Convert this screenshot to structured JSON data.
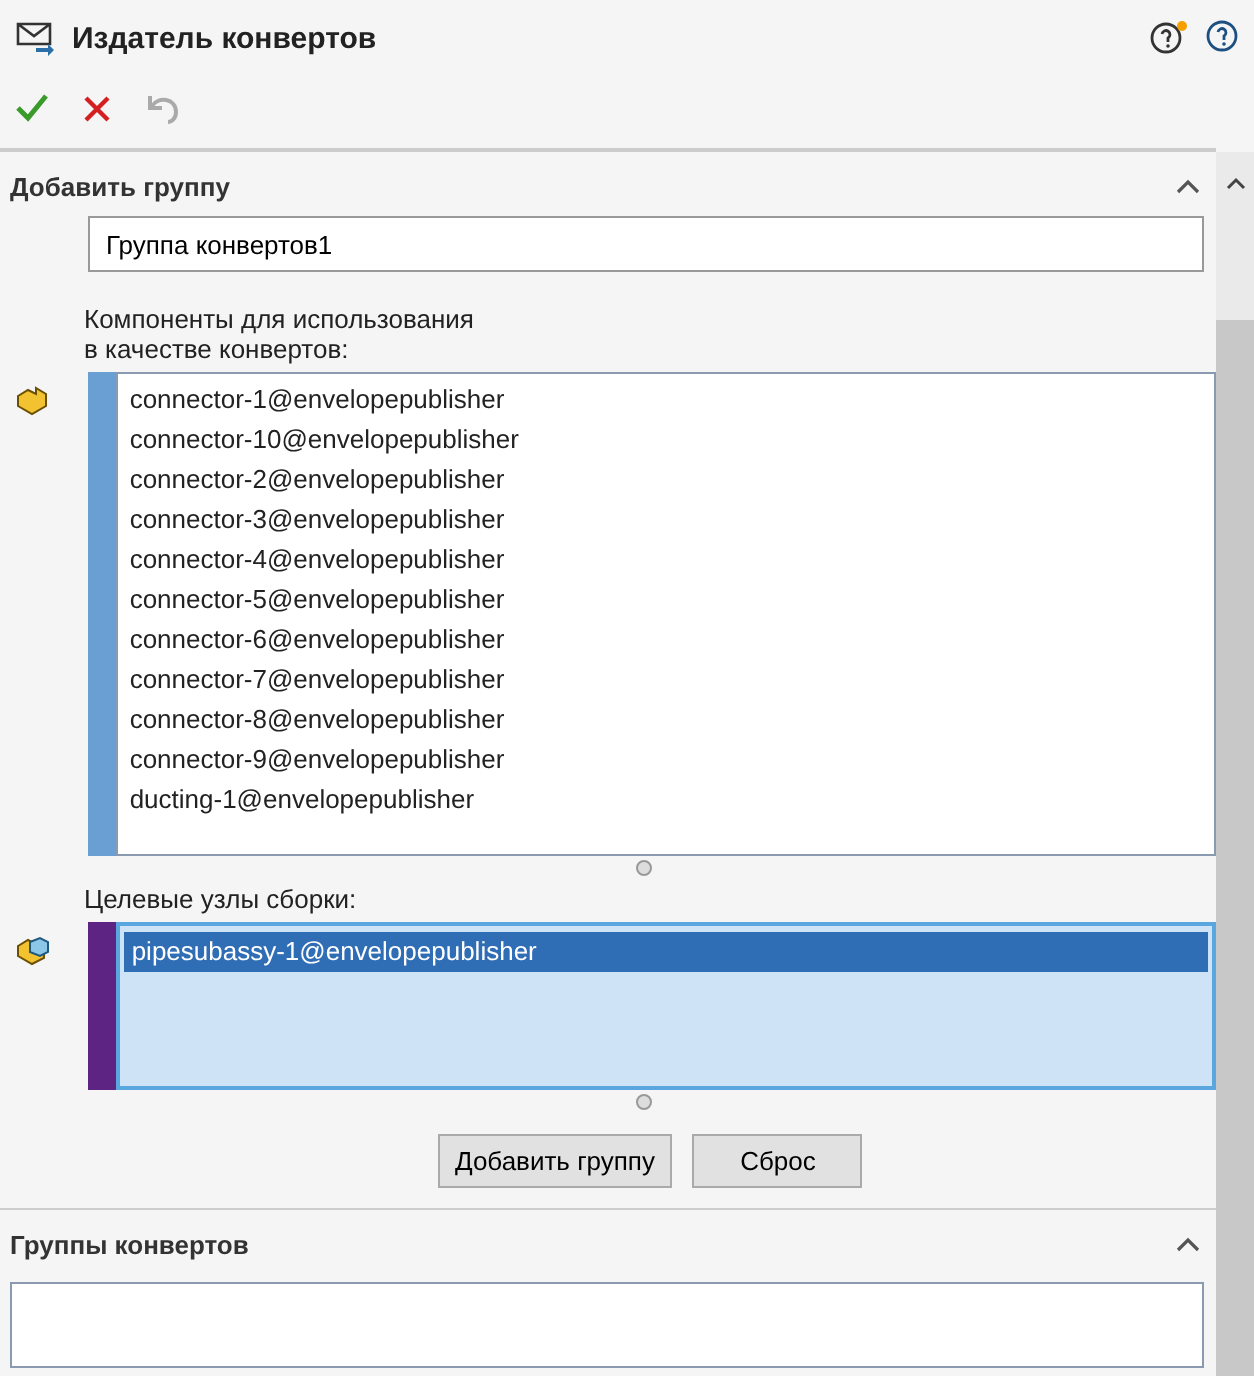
{
  "window": {
    "title": "Издатель конвертов"
  },
  "toolbar": [
    {
      "kind": "ok",
      "disabled": false
    },
    {
      "kind": "cancel",
      "disabled": false
    },
    {
      "kind": "undo",
      "disabled": true
    }
  ],
  "add_group": {
    "title": "Добавить группу",
    "expanded": true,
    "name_value": "Группа конвертов1",
    "components_label": "Компоненты для использования\nв качестве конвертов:",
    "components": [
      {
        "label": "connector-1@envelopepublisher",
        "selected": false
      },
      {
        "label": "connector-10@envelopepublisher",
        "selected": false
      },
      {
        "label": "connector-2@envelopepublisher",
        "selected": false
      },
      {
        "label": "connector-3@envelopepublisher",
        "selected": false
      },
      {
        "label": "connector-4@envelopepublisher",
        "selected": false
      },
      {
        "label": "connector-5@envelopepublisher",
        "selected": false
      },
      {
        "label": "connector-6@envelopepublisher",
        "selected": false
      },
      {
        "label": "connector-7@envelopepublisher",
        "selected": false
      },
      {
        "label": "connector-8@envelopepublisher",
        "selected": false
      },
      {
        "label": "connector-9@envelopepublisher",
        "selected": false
      },
      {
        "label": "ducting-1@envelopepublisher",
        "selected": false
      }
    ],
    "targets_label": "Целевые узлы сборки:",
    "targets": [
      {
        "label": "pipesubassy-1@envelopepublisher",
        "selected": true
      }
    ],
    "buttons": [
      "Добавить группу",
      "Сброс"
    ]
  },
  "groups": {
    "title": "Группы конвертов",
    "expanded": true
  }
}
